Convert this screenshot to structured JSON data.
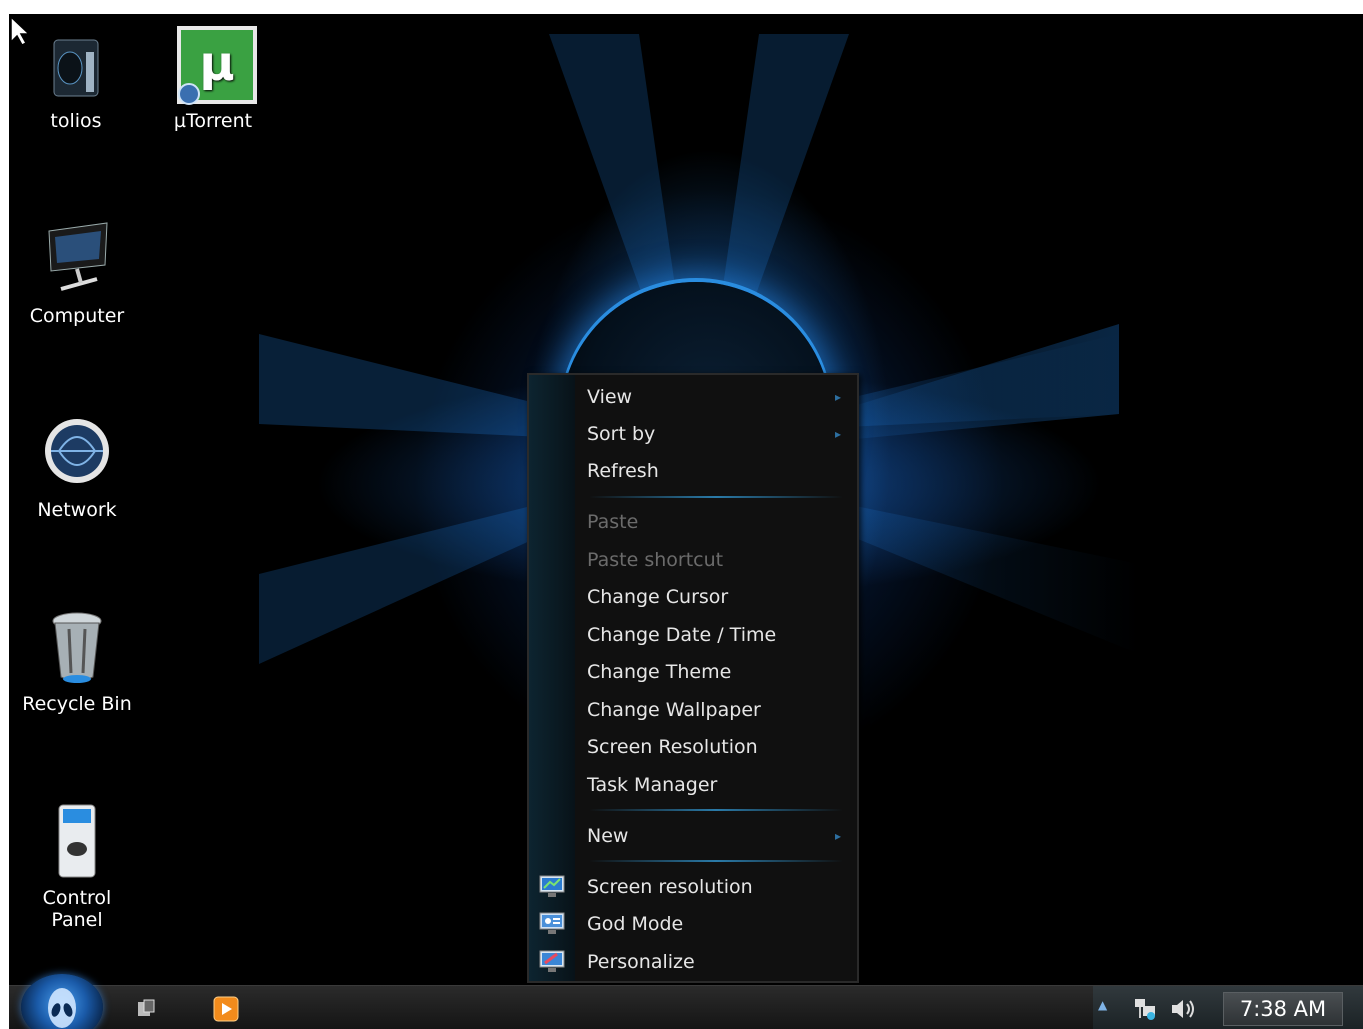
{
  "desktop": {
    "icons": [
      {
        "label": "tolios",
        "icon": "alienware-folder-icon"
      },
      {
        "label": "µTorrent",
        "icon": "utorrent-icon"
      },
      {
        "label": "Computer",
        "icon": "computer-icon"
      },
      {
        "label": "Network",
        "icon": "network-icon"
      },
      {
        "label": "Recycle Bin",
        "icon": "recycle-bin-icon"
      },
      {
        "label": "Control Panel",
        "icon": "control-panel-icon"
      }
    ]
  },
  "context_menu": {
    "items": [
      {
        "label": "View",
        "submenu": true
      },
      {
        "label": "Sort by",
        "submenu": true
      },
      {
        "label": "Refresh"
      },
      {
        "label": "Paste",
        "disabled": true
      },
      {
        "label": "Paste shortcut",
        "disabled": true
      },
      {
        "label": "Change Cursor"
      },
      {
        "label": "Change Date / Time"
      },
      {
        "label": "Change Theme"
      },
      {
        "label": "Change Wallpaper"
      },
      {
        "label": "Screen Resolution"
      },
      {
        "label": "Task Manager"
      },
      {
        "label": "New",
        "submenu": true
      },
      {
        "label": "Screen resolution",
        "icon": "display-icon"
      },
      {
        "label": "God Mode",
        "icon": "control-panel-monitor-icon"
      },
      {
        "label": "Personalize",
        "icon": "personalize-icon"
      }
    ],
    "submenu_arrow": "▸"
  },
  "taskbar": {
    "pinned": [
      "explorer-icon",
      "media-player-icon"
    ],
    "tray": {
      "expand_arrow": "▲",
      "icons": [
        "network-tray-icon",
        "volume-icon"
      ],
      "clock": "7:38 AM"
    }
  },
  "colors": {
    "accent": "#2a8de0",
    "menu_bg": "#101010",
    "disabled_text": "#6b6b6b"
  }
}
